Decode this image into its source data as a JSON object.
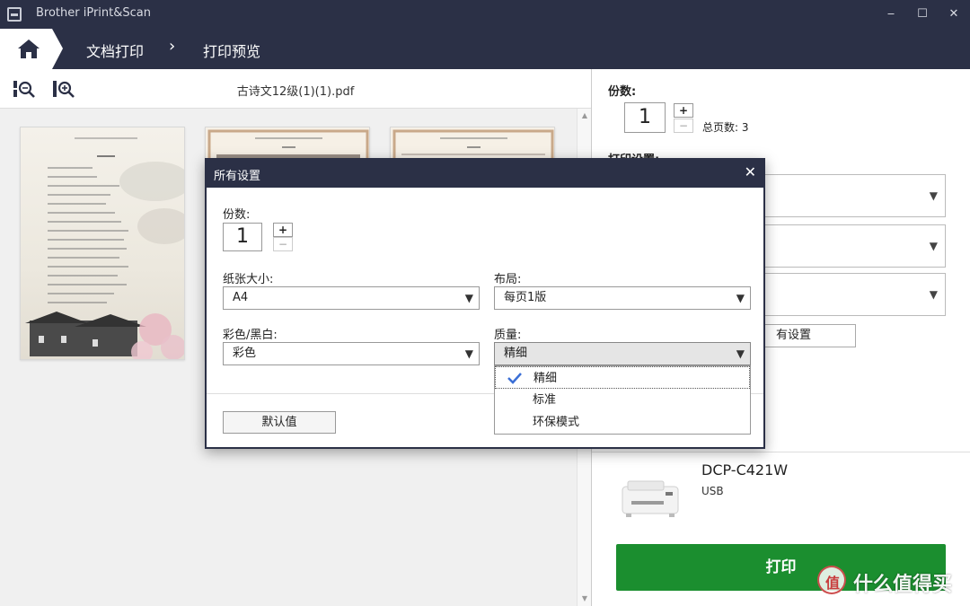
{
  "window": {
    "title": "Brother iPrint&Scan",
    "minimize": "‒",
    "maximize": "☐",
    "close": "✕"
  },
  "nav": {
    "crumb1": "文档打印",
    "crumb2": "打印预览",
    "separator": "›"
  },
  "toolbar": {
    "filename": "古诗文12级(1)(1).pdf"
  },
  "right": {
    "copies_label": "份数:",
    "copies_value": "1",
    "plus": "+",
    "minus": "−",
    "total_pages": "总页数: 3",
    "print_settings_label": "打印设置:",
    "all_settings_button": "有设置",
    "printer_name": "DCP-C421W",
    "printer_connection": "USB",
    "print_button": "打印"
  },
  "dialog": {
    "title": "所有设置",
    "close": "✕",
    "copies_label": "份数:",
    "copies_value": "1",
    "plus": "+",
    "minus": "−",
    "paper_size_label": "纸张大小:",
    "paper_size_value": "A4",
    "layout_label": "布局:",
    "layout_value": "每页1版",
    "color_label": "彩色/黑白:",
    "color_value": "彩色",
    "quality_label": "质量:",
    "quality_value": "精细",
    "default_button": "默认值",
    "quality_options": [
      "精细",
      "标准",
      "环保模式"
    ],
    "caret": "▼"
  },
  "watermark": {
    "text": "什么值得买",
    "logo_text": "值"
  },
  "colors": {
    "nav_bg": "#2b3046",
    "print_green": "#1b8e2f",
    "check_blue": "#3b6fd6"
  }
}
